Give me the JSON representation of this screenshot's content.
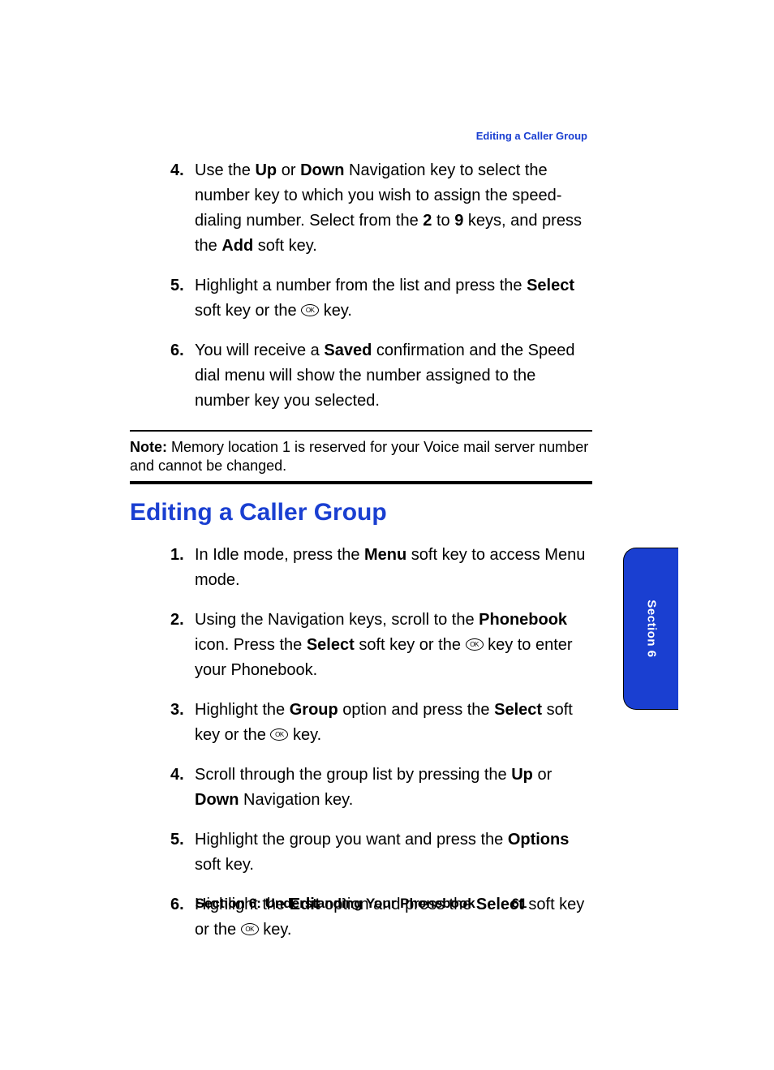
{
  "runningHead": "Editing a Caller Group",
  "topSteps": [
    {
      "n": "4.",
      "segments": [
        {
          "t": "Use the "
        },
        {
          "t": "Up",
          "b": true
        },
        {
          "t": " or "
        },
        {
          "t": "Down",
          "b": true
        },
        {
          "t": " Navigation key to select the number key to which you wish to assign the speed-dialing number. Select from the "
        },
        {
          "t": "2",
          "b": true
        },
        {
          "t": " to "
        },
        {
          "t": "9",
          "b": true
        },
        {
          "t": " keys, and press the "
        },
        {
          "t": "Add",
          "b": true
        },
        {
          "t": " soft key."
        }
      ]
    },
    {
      "n": "5.",
      "segments": [
        {
          "t": "Highlight a number from the list and press the "
        },
        {
          "t": "Select",
          "b": true
        },
        {
          "t": " soft key or the "
        },
        {
          "ok": true
        },
        {
          "t": " key."
        }
      ]
    },
    {
      "n": "6.",
      "segments": [
        {
          "t": "You will receive a "
        },
        {
          "t": "Saved",
          "b": true
        },
        {
          "t": " confirmation and the Speed dial menu will show the number assigned to the number key you selected."
        }
      ]
    }
  ],
  "noteLabel": "Note:",
  "noteText": " Memory location 1 is reserved for your Voice mail server number and cannot be changed.",
  "heading": "Editing a Caller Group",
  "bottomSteps": [
    {
      "n": "1.",
      "segments": [
        {
          "t": "In Idle mode, press the "
        },
        {
          "t": "Menu",
          "b": true
        },
        {
          "t": " soft key to access Menu mode."
        }
      ]
    },
    {
      "n": "2.",
      "segments": [
        {
          "t": "Using the Navigation keys, scroll to the "
        },
        {
          "t": "Phonebook",
          "b": true
        },
        {
          "t": " icon. Press the "
        },
        {
          "t": "Select",
          "b": true
        },
        {
          "t": " soft key or the "
        },
        {
          "ok": true
        },
        {
          "t": " key to enter your Phonebook."
        }
      ]
    },
    {
      "n": "3.",
      "segments": [
        {
          "t": "Highlight the "
        },
        {
          "t": "Group",
          "b": true
        },
        {
          "t": " option and press the "
        },
        {
          "t": "Select",
          "b": true
        },
        {
          "t": " soft key or the "
        },
        {
          "ok": true
        },
        {
          "t": " key."
        }
      ]
    },
    {
      "n": "4.",
      "segments": [
        {
          "t": "Scroll through the group list by pressing the "
        },
        {
          "t": "Up",
          "b": true
        },
        {
          "t": " or "
        },
        {
          "t": "Down",
          "b": true
        },
        {
          "t": " Navigation key."
        }
      ]
    },
    {
      "n": "5.",
      "segments": [
        {
          "t": "Highlight the group you want and press the "
        },
        {
          "t": "Options",
          "b": true
        },
        {
          "t": " soft key."
        }
      ]
    },
    {
      "n": "6.",
      "segments": [
        {
          "t": "Highlight the "
        },
        {
          "t": "Edit",
          "b": true
        },
        {
          "t": " option and press the "
        },
        {
          "t": "Select",
          "b": true
        },
        {
          "t": " soft key or the "
        },
        {
          "ok": true
        },
        {
          "t": " key."
        }
      ]
    }
  ],
  "sideTab": "Section 6",
  "okGlyph": "OK",
  "footerSection": "Section 6: Understanding Your Phonebook",
  "footerPage": "61"
}
